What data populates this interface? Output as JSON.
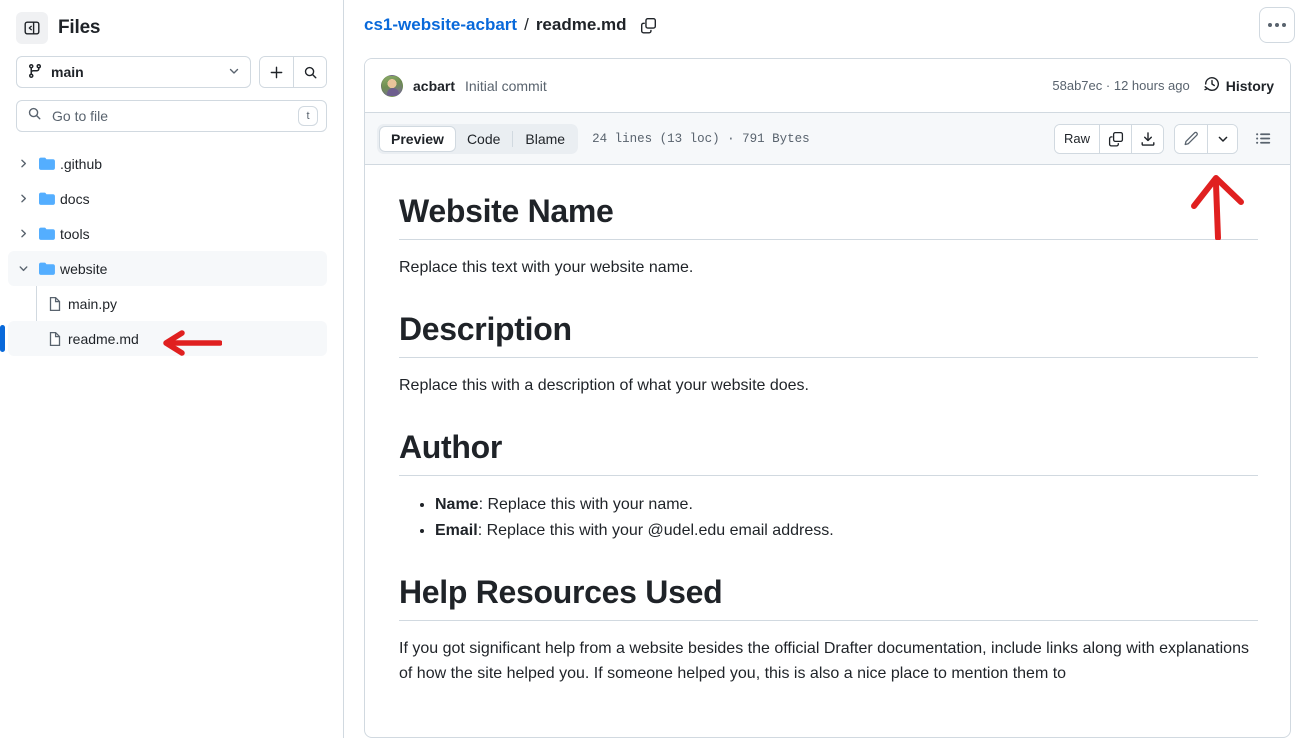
{
  "sidebar": {
    "panel_toggle_icon": "sidebar-collapse-icon",
    "title": "Files",
    "branch": {
      "icon": "git-branch-icon",
      "name": "main",
      "caret_icon": "chevron-down-icon"
    },
    "actions": [
      {
        "icon": "plus-icon",
        "name": "add-file-button"
      },
      {
        "icon": "search-icon",
        "name": "search-button"
      }
    ],
    "search": {
      "icon": "search-icon",
      "value": "",
      "placeholder": "Go to file",
      "shortcut": "t"
    },
    "tree": [
      {
        "label": ".github",
        "type": "folder",
        "expanded": false,
        "selected": false,
        "child": false
      },
      {
        "label": "docs",
        "type": "folder",
        "expanded": false,
        "selected": false,
        "child": false
      },
      {
        "label": "tools",
        "type": "folder",
        "expanded": false,
        "selected": false,
        "child": false
      },
      {
        "label": "website",
        "type": "folder",
        "expanded": true,
        "selected": true,
        "child": false
      },
      {
        "label": "main.py",
        "type": "file",
        "expanded": false,
        "selected": false,
        "child": true
      },
      {
        "label": "readme.md",
        "type": "file",
        "expanded": false,
        "selected": true,
        "child": true
      }
    ]
  },
  "header": {
    "repo": "cs1-website-acbart",
    "separator": "/",
    "file": "readme.md",
    "copy_icon": "copy-path-icon",
    "menu_icon": "kebab-horizontal-icon"
  },
  "commit": {
    "avatar_alt": "acbart",
    "author": "acbart",
    "message": "Initial commit",
    "sha": "58ab7ec",
    "dot": "·",
    "relative_time": "12 hours ago",
    "history_label": "History",
    "history_icon": "history-clock-icon"
  },
  "file_toolbar": {
    "tabs": [
      {
        "label": "Preview",
        "active": true
      },
      {
        "label": "Code",
        "active": false
      },
      {
        "label": "Blame",
        "active": false
      }
    ],
    "meta": "24 lines (13 loc) · 791 Bytes",
    "raw_label": "Raw",
    "copy_icon": "copy-icon",
    "download_icon": "download-icon",
    "edit_icon": "pencil-icon",
    "edit_caret_icon": "chevron-down-icon",
    "outline_icon": "list-unordered-icon"
  },
  "document": {
    "sections": [
      {
        "heading": "Website Name",
        "paragraph": "Replace this text with your website name."
      },
      {
        "heading": "Description",
        "paragraph": "Replace this with a description of what your website does."
      },
      {
        "heading": "Author",
        "bullets": [
          {
            "label": "Name",
            "text": ": Replace this with your name."
          },
          {
            "label": "Email",
            "text": ": Replace this with your @udel.edu email address."
          }
        ]
      },
      {
        "heading": "Help Resources Used",
        "paragraph": "If you got significant help from a website besides the official Drafter documentation, include links along with explanations of how the site helped you. If someone helped you, this is also a nice place to mention them to"
      }
    ]
  },
  "annotations": [
    {
      "name": "arrow-pointing-to-readme",
      "color": "#e02020",
      "direction": "left"
    },
    {
      "name": "arrow-pointing-to-edit-button",
      "color": "#e02020",
      "direction": "up"
    }
  ],
  "colors": {
    "link": "#0969da",
    "border": "#d1d9e0",
    "muted": "#59636e",
    "selected_bg": "#f6f8fa",
    "annotation": "#e02020"
  }
}
